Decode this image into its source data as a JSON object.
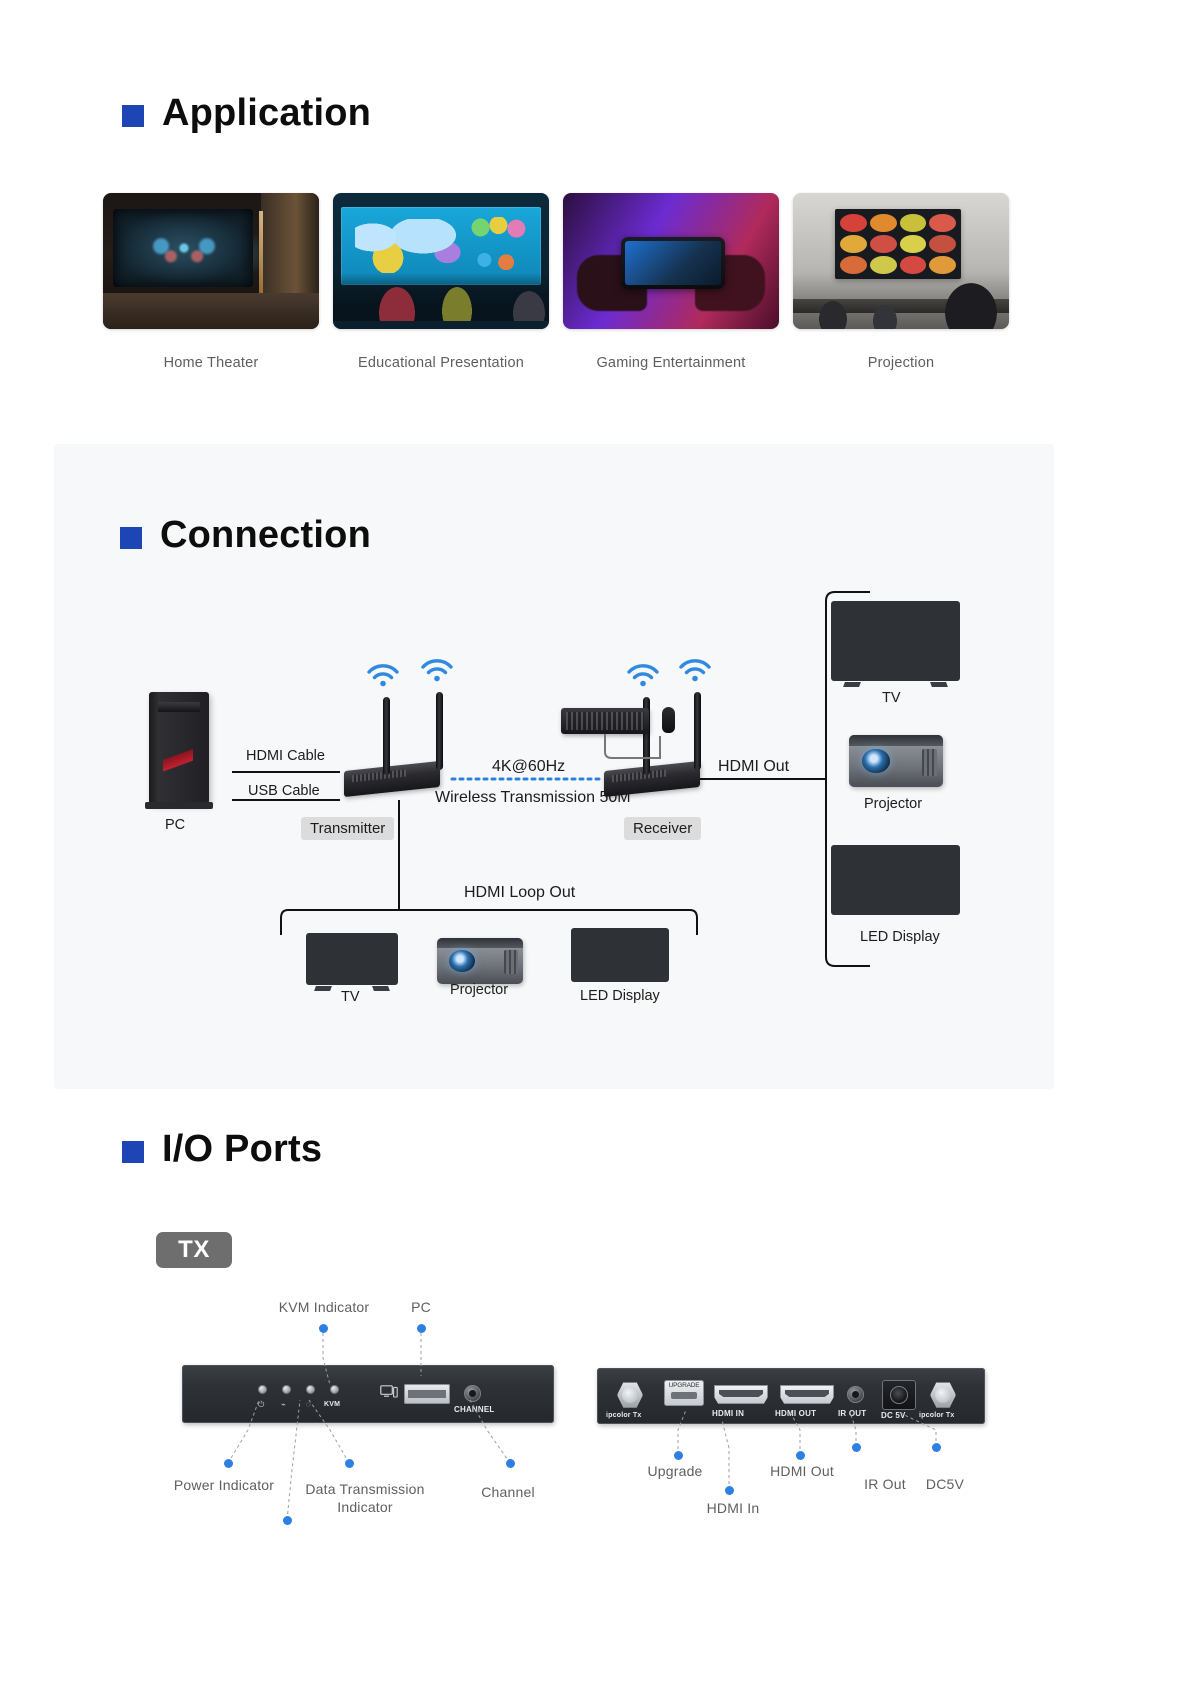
{
  "sections": {
    "application": {
      "title": "Application",
      "cards": [
        {
          "caption": "Home Theater",
          "art": "home-theater"
        },
        {
          "caption": "Educational Presentation",
          "art": "educational-presentation"
        },
        {
          "caption": "Gaming Entertainment",
          "art": "gaming-entertainment"
        },
        {
          "caption": "Projection",
          "art": "projection"
        }
      ]
    },
    "connection": {
      "title": "Connection",
      "labels": {
        "pc": "PC",
        "hdmi_cable": "HDMI Cable",
        "usb_cable": "USB Cable",
        "transmitter": "Transmitter",
        "receiver": "Receiver",
        "resolution": "4K@60Hz",
        "wireless": "Wireless Transmission 50M",
        "hdmi_out": "HDMI Out",
        "hdmi_loop_out": "HDMI Loop Out"
      },
      "right_devices": [
        {
          "label": "TV"
        },
        {
          "label": "Projector"
        },
        {
          "label": "LED Display"
        }
      ],
      "loop_devices": [
        {
          "label": "TV"
        },
        {
          "label": "Projector"
        },
        {
          "label": "LED Display"
        }
      ]
    },
    "io_ports": {
      "title": "I/O Ports",
      "badge": "TX",
      "front_panel": {
        "port_labels": {
          "kvm": "KVM",
          "channel": "CHANNEL"
        },
        "callouts_top": [
          {
            "label": "KVM Indicator"
          },
          {
            "label": "PC"
          }
        ],
        "callouts_bottom": [
          {
            "label": "Power Indicator"
          },
          {
            "label": "Data Transmission Indicator"
          },
          {
            "label": "Channel"
          }
        ]
      },
      "rear_panel": {
        "port_labels": {
          "ipcolor_left": "ipcolor Tx",
          "upgrade": "UPGRADE",
          "hdmi_in": "HDMI IN",
          "hdmi_out": "HDMI OUT",
          "ir_out": "IR OUT",
          "dc": "DC 5V",
          "ipcolor_right": "ipcolor Tx"
        },
        "callouts": [
          {
            "label": "Upgrade"
          },
          {
            "label": "HDMI In"
          },
          {
            "label": "HDMI Out"
          },
          {
            "label": "IR Out"
          },
          {
            "label": "DC5V"
          }
        ]
      }
    }
  },
  "colors": {
    "accent": "#1d46b4",
    "panel_bg": "#f7f8f9",
    "callout_dot": "#2f7fe0",
    "chip_bg": "#dcdcdc",
    "badge_bg": "#6e6e6e"
  }
}
